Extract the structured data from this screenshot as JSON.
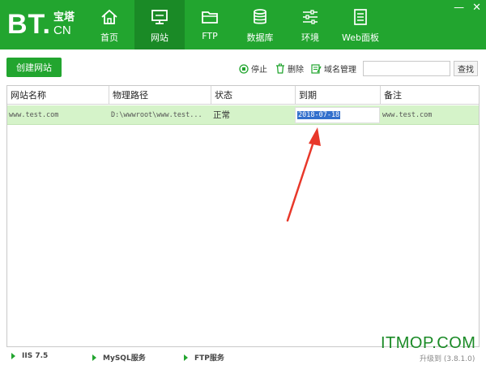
{
  "app": {
    "logo_bt": "BT.",
    "logo_cn_top": "宝塔",
    "logo_cn_bottom": "CN"
  },
  "nav": {
    "items": [
      {
        "label": "首页",
        "icon": "home-icon"
      },
      {
        "label": "网站",
        "icon": "monitor-icon",
        "active": true
      },
      {
        "label": "FTP",
        "icon": "folder-icon"
      },
      {
        "label": "数据库",
        "icon": "database-icon"
      },
      {
        "label": "环境",
        "icon": "sliders-icon"
      },
      {
        "label": "Web面板",
        "icon": "panel-icon"
      }
    ]
  },
  "window_controls": {
    "minimize": "—",
    "close": "✕"
  },
  "toolbar": {
    "create_label": "创建网站",
    "stop_label": "停止",
    "delete_label": "删除",
    "domain_label": "域名管理",
    "search_placeholder": "",
    "search_value": "",
    "search_button": "查找"
  },
  "table": {
    "columns": [
      "网站名称",
      "物理路径",
      "状态",
      "到期",
      "备注"
    ],
    "rows": [
      {
        "name": "www.test.com",
        "path": "D:\\wwwroot\\www.test...",
        "status": "正常",
        "expire": "2018-07-18",
        "note": "www.test.com"
      }
    ]
  },
  "watermark": "ITMOP.COM",
  "statusbar": {
    "services": [
      "IIS 7.5",
      "MySQL服务",
      "FTP服务"
    ],
    "upgrade": "升级到 (3.8.1.0)"
  },
  "colors": {
    "brand_green": "#22a52f",
    "row_highlight": "#d5f3c9",
    "selection_blue": "#3370cc",
    "annotation_red": "#e8382a"
  }
}
